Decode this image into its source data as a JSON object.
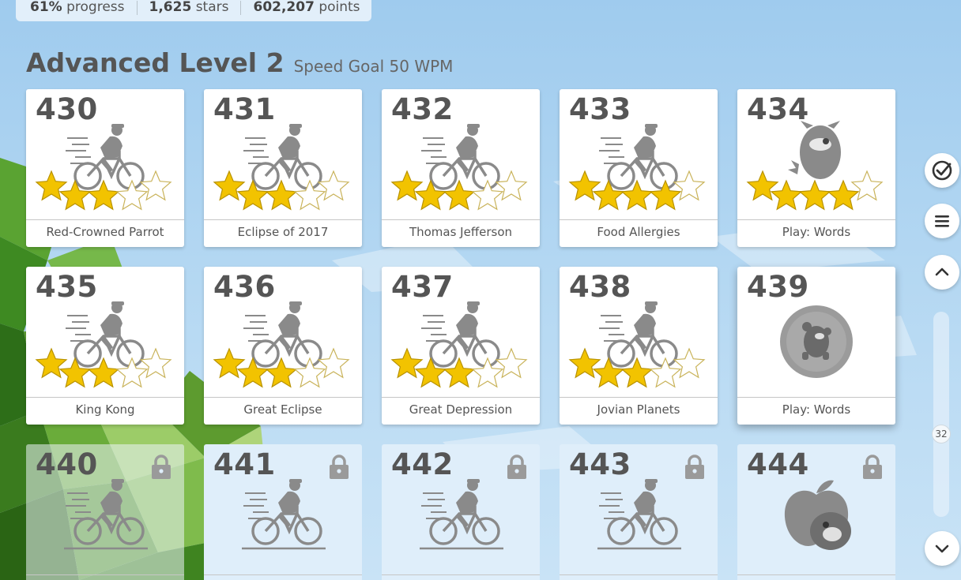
{
  "stats": {
    "progress_value": "61%",
    "progress_label": "progress",
    "stars_value": "1,625",
    "stars_label": "stars",
    "points_value": "602,207",
    "points_label": "points"
  },
  "section": {
    "title": "Advanced Level 2",
    "goal": "Speed Goal 50 WPM"
  },
  "lessons": [
    {
      "num": "430",
      "label": "Red-Crowned Parrot",
      "icon": "bicycle-rider-icon",
      "stars": 3,
      "state": "done"
    },
    {
      "num": "431",
      "label": "Eclipse of 2017",
      "icon": "bicycle-rider-icon",
      "stars": 3,
      "state": "done"
    },
    {
      "num": "432",
      "label": "Thomas Jefferson",
      "icon": "bicycle-rider-icon",
      "stars": 3,
      "state": "done"
    },
    {
      "num": "433",
      "label": "Food Allergies",
      "icon": "bicycle-rider-icon",
      "stars": 4,
      "state": "done"
    },
    {
      "num": "434",
      "label": "Play: Words",
      "icon": "monster-mascot-icon",
      "stars": 4,
      "state": "done"
    },
    {
      "num": "435",
      "label": "King Kong",
      "icon": "bicycle-rider-icon",
      "stars": 3,
      "state": "done"
    },
    {
      "num": "436",
      "label": "Great Eclipse",
      "icon": "bicycle-rider-icon",
      "stars": 3,
      "state": "done"
    },
    {
      "num": "437",
      "label": "Great Depression",
      "icon": "bicycle-rider-icon",
      "stars": 3,
      "state": "done"
    },
    {
      "num": "438",
      "label": "Jovian Planets",
      "icon": "bicycle-rider-icon",
      "stars": 3,
      "state": "done"
    },
    {
      "num": "439",
      "label": "Play: Words",
      "icon": "mascot-bubble-icon",
      "stars": 0,
      "state": "current"
    },
    {
      "num": "440",
      "label": "",
      "icon": "bicycle-rider-icon",
      "stars": 0,
      "state": "locked"
    },
    {
      "num": "441",
      "label": "",
      "icon": "bicycle-rider-icon",
      "stars": 0,
      "state": "locked"
    },
    {
      "num": "442",
      "label": "",
      "icon": "bicycle-rider-icon",
      "stars": 0,
      "state": "locked"
    },
    {
      "num": "443",
      "label": "",
      "icon": "bicycle-rider-icon",
      "stars": 0,
      "state": "locked"
    },
    {
      "num": "444",
      "label": "",
      "icon": "apple-mascot-icon",
      "stars": 0,
      "state": "locked"
    }
  ],
  "sidebar": {
    "buttons": [
      {
        "name": "check-circle-icon"
      },
      {
        "name": "menu-icon"
      },
      {
        "name": "chevron-up-icon"
      },
      {
        "name": "chevron-down-icon"
      }
    ],
    "scroll_value": "32",
    "scroll_fraction": 0.61
  },
  "colors": {
    "star_gold": "#f2c300",
    "star_outline": "#b89200",
    "icon_gray": "#8a8a8a",
    "text": "#555555",
    "sky": "#aed4f0"
  }
}
